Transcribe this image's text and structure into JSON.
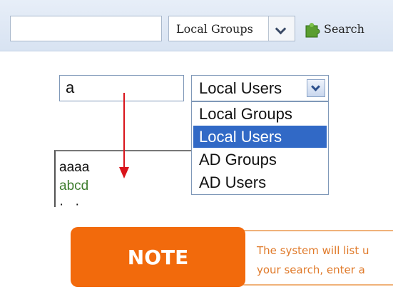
{
  "toolbar": {
    "search_value": "",
    "scope_select_value": "Local Groups",
    "search_button_label": "Search"
  },
  "demo": {
    "search_value": "a",
    "scope_select_value": "Local Users",
    "options": [
      "Local Groups",
      "Local Users",
      "AD Groups",
      "AD Users"
    ],
    "selected_option": "Local Users",
    "results": [
      "aaaa",
      "abcd"
    ]
  },
  "note": {
    "label": "NOTE",
    "text_line1": "The system will list u",
    "text_line2": "your search, enter a"
  },
  "colors": {
    "note_orange": "#f26a0c",
    "selection_blue": "#3169c6",
    "arrow_red": "#d9141b",
    "result_green": "#3e7d2e"
  }
}
